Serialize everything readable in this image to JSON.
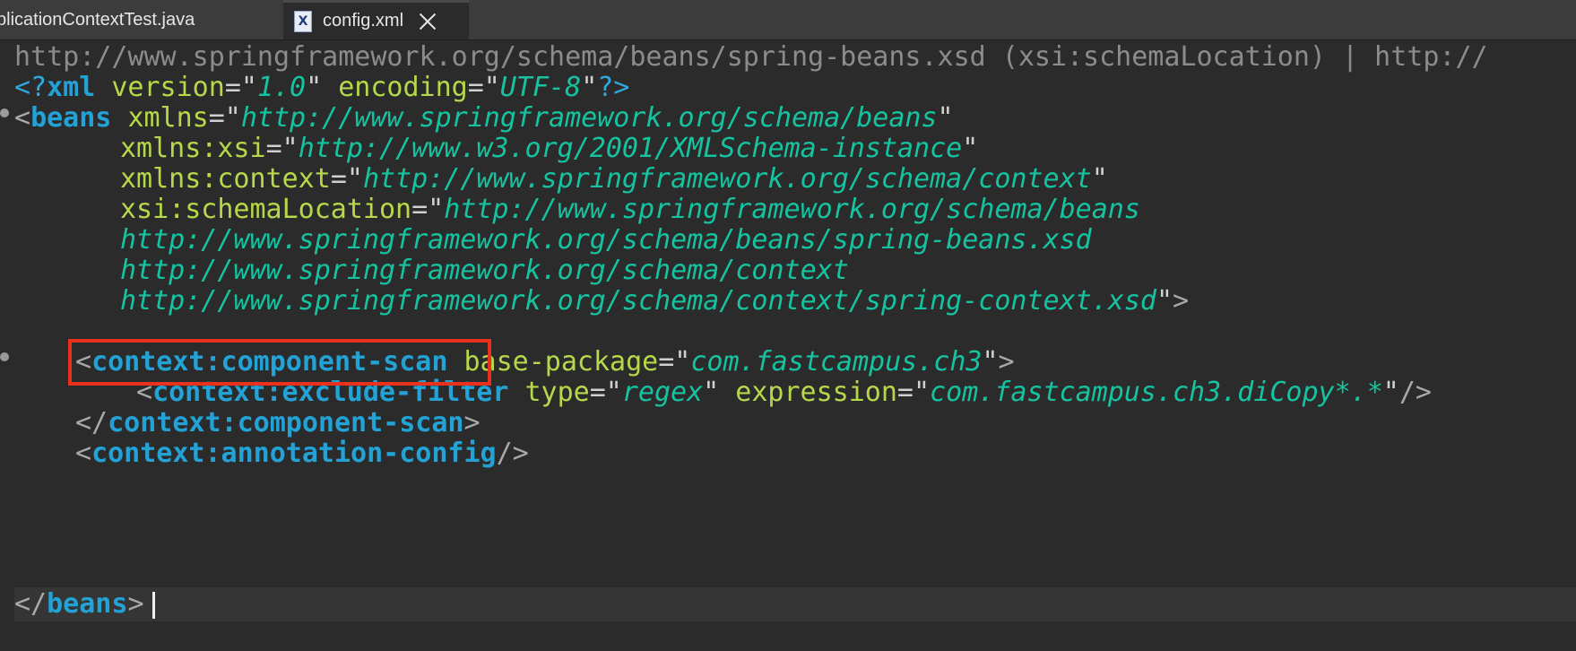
{
  "tabs": [
    {
      "label": "plicationContextTest.java",
      "active": false
    },
    {
      "label": "config.xml",
      "active": true
    }
  ],
  "icons": {
    "file": "xml-file-icon",
    "close": "close-icon"
  },
  "header_line": "http://www.springframework.org/schema/beans/spring-beans.xsd (xsi:schemaLocation) | http://",
  "code": {
    "decl": {
      "open": "<?",
      "name": "xml",
      "a1": "version",
      "v1": "1.0",
      "a2": "encoding",
      "v2": "UTF-8",
      "close": "?>"
    },
    "beans_open": {
      "tag": "beans",
      "attr": "xmlns",
      "val": "http://www.springframework.org/schema/beans"
    },
    "xmlns_xsi": {
      "attr": "xmlns:xsi",
      "val": "http://www.w3.org/2001/XMLSchema-instance"
    },
    "xmlns_context": {
      "attr": "xmlns:context",
      "val": "http://www.springframework.org/schema/context"
    },
    "schema_location": {
      "attr": "xsi:schemaLocation",
      "val": "http://www.springframework.org/schema/beans"
    },
    "schema_line2": "http://www.springframework.org/schema/beans/spring-beans.xsd",
    "schema_line3": "http://www.springframework.org/schema/context",
    "schema_line4": "http://www.springframework.org/schema/context/spring-context.xsd",
    "component_scan": {
      "tag": "context:component-scan",
      "attr": "base-package",
      "val": "com.fastcampus.ch3"
    },
    "exclude_filter": {
      "tag": "context:exclude-filter",
      "a1": "type",
      "v1": "regex",
      "a2": "expression",
      "v2": "com.fastcampus.ch3.diCopy*.*"
    },
    "component_scan_close": "context:component-scan",
    "annotation_config": "context:annotation-config",
    "beans_close": "beans"
  },
  "colors": {
    "background": "#2b2b2b",
    "tag": "#23a2d6",
    "attribute": "#b6d84a",
    "value": "#16c3a0",
    "highlight": "#e8321e"
  }
}
